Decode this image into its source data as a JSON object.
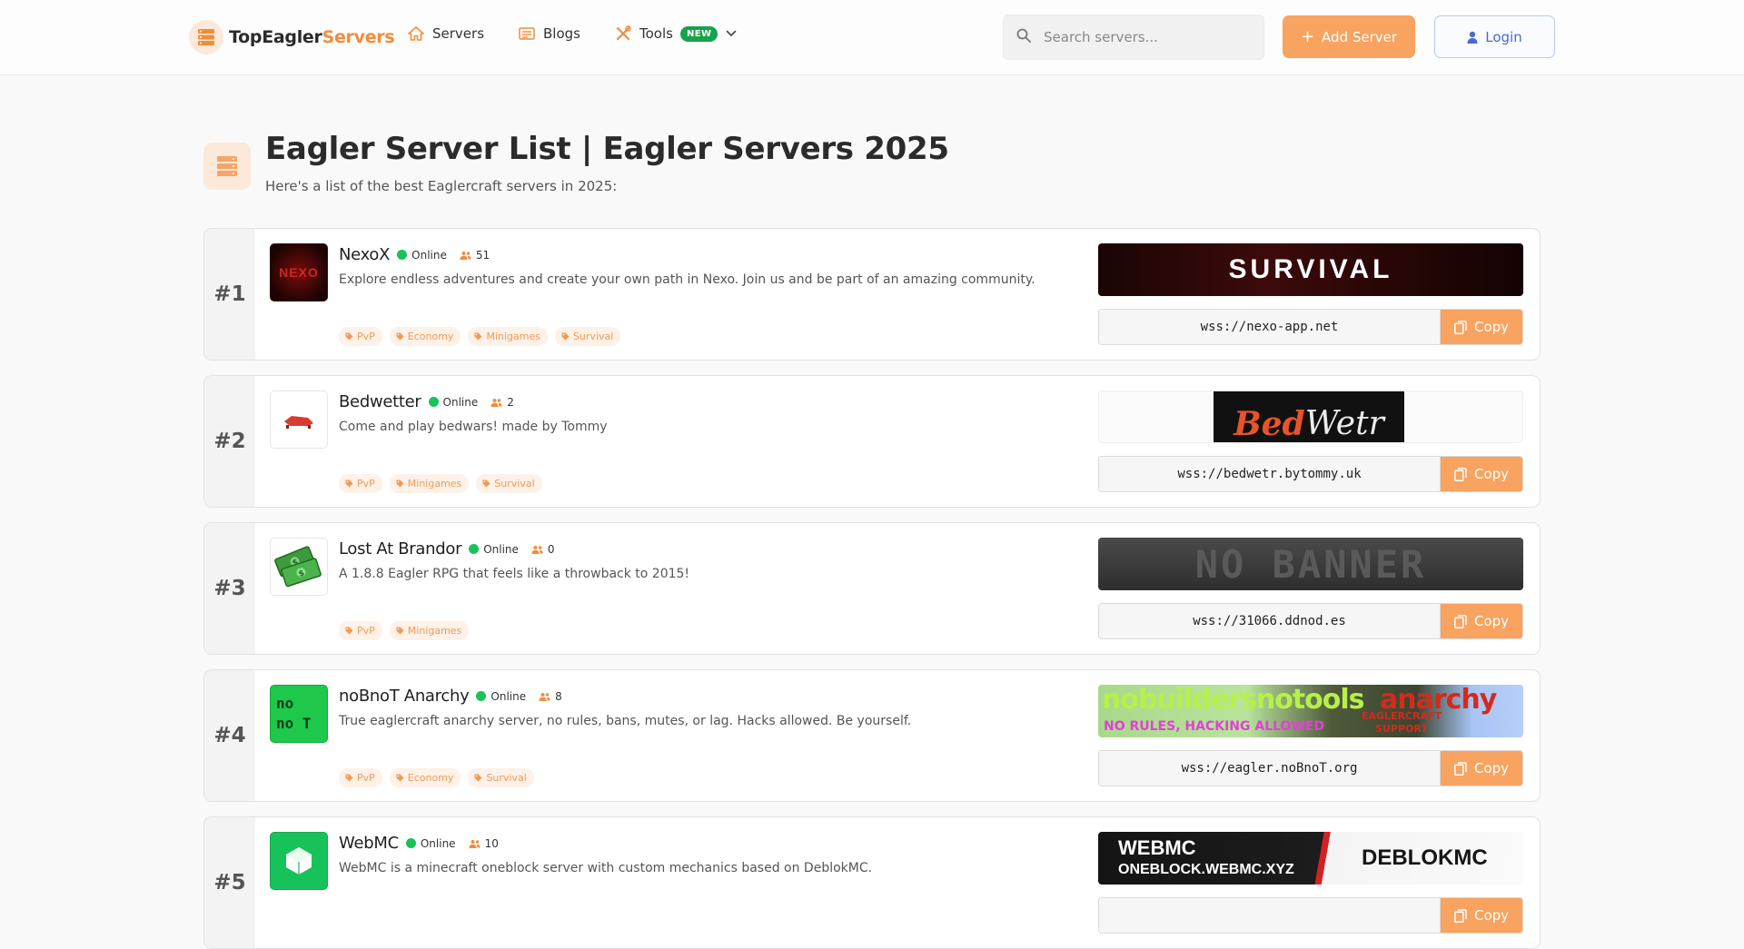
{
  "brand": {
    "name_main": "TopEagler",
    "name_accent": "Servers",
    "logo_icon": "server-stack-icon",
    "accent_color": "#f28c3b"
  },
  "nav": {
    "items": [
      {
        "label": "Servers",
        "icon": "home-icon"
      },
      {
        "label": "Blogs",
        "icon": "newspaper-icon"
      },
      {
        "label": "Tools",
        "icon": "tools-icon",
        "badge": "NEW"
      }
    ]
  },
  "search": {
    "placeholder": "Search servers..."
  },
  "actions": {
    "add_server": "Add Server",
    "login": "Login"
  },
  "page": {
    "title": "Eagler Server List | Eagler Servers 2025",
    "subtitle": "Here's a list of the best Eaglercraft servers in 2025:"
  },
  "servers": [
    {
      "rank": "#1",
      "name": "NexoX",
      "status": "Online",
      "players": "51",
      "description": "Explore endless adventures and create your own path in Nexo. Join us and be part of an amazing community.",
      "tags": [
        "PvP",
        "Economy",
        "Minigames",
        "Survival"
      ],
      "banner_text": "SURVIVAL",
      "logo_text": "NEXO",
      "ip": "wss://nexo-app.net",
      "copy_label": "Copy"
    },
    {
      "rank": "#2",
      "name": "Bedwetter",
      "status": "Online",
      "players": "2",
      "description": "Come and play bedwars! made by Tommy",
      "tags": [
        "PvP",
        "Minigames",
        "Survival"
      ],
      "banner_text_a": "Bed",
      "banner_text_b": "Wetr",
      "ip": "wss://bedwetr.bytommy.uk",
      "copy_label": "Copy"
    },
    {
      "rank": "#3",
      "name": "Lost At Brandor",
      "status": "Online",
      "players": "0",
      "description": "A 1.8.8 Eagler RPG that feels like a throwback to 2015!",
      "tags": [
        "PvP",
        "Minigames"
      ],
      "banner_text": "NO BANNER",
      "ip": "wss://31066.ddnod.es",
      "copy_label": "Copy"
    },
    {
      "rank": "#4",
      "name": "noBnoT Anarchy",
      "status": "Online",
      "players": "8",
      "description": "True eaglercraft anarchy server, no rules, bans, mutes, or lag. Hacks allowed. Be yourself.",
      "tags": [
        "PvP",
        "Economy",
        "Survival"
      ],
      "logo_line1": "no",
      "logo_line2": "no T",
      "banner_text_a": "nobuildersnotools",
      "banner_text_b": "anarchy",
      "banner_text_c": "NO RULES, HACKING ALLOWED",
      "banner_text_d": "EAGLERCRAFT SUPPORT",
      "ip": "wss://eagler.noBnoT.org",
      "copy_label": "Copy"
    },
    {
      "rank": "#5",
      "name": "WebMC",
      "status": "Online",
      "players": "10",
      "description": "WebMC is a minecraft oneblock server with custom mechanics based on DeblokMC.",
      "tags": [],
      "banner_text_a": "WEBMC",
      "banner_text_b": "ONEBLOCK.WEBMC.XYZ",
      "banner_text_c": "DEBLOKMC",
      "ip": "",
      "copy_label": "Copy"
    }
  ]
}
